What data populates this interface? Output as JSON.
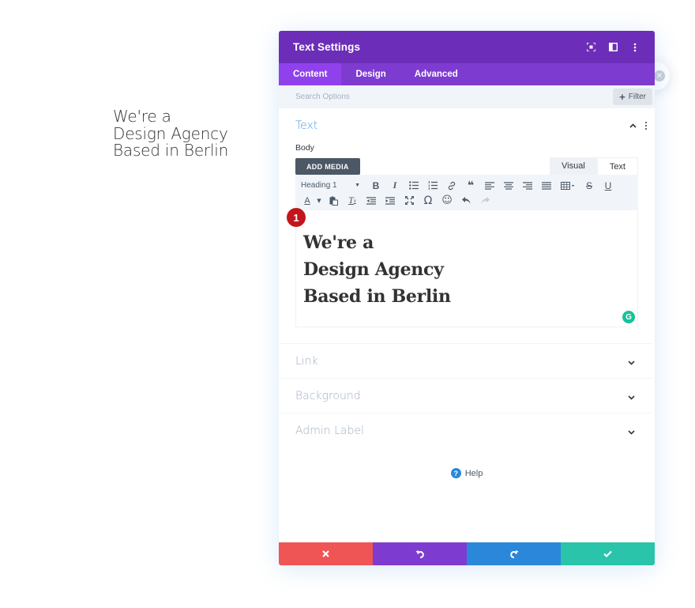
{
  "preview": {
    "lines": [
      "We're a",
      "Design Agency",
      "Based in Berlin"
    ]
  },
  "modal": {
    "title": "Text Settings",
    "header_icons": [
      "focus-icon",
      "split-view-icon",
      "more-options-icon"
    ],
    "tabs": [
      {
        "label": "Content",
        "active": true
      },
      {
        "label": "Design",
        "active": false
      },
      {
        "label": "Advanced",
        "active": false
      }
    ],
    "search": {
      "placeholder": "Search Options"
    },
    "filter": {
      "label": "Filter",
      "icon": "plus-icon"
    },
    "text_section": {
      "title": "Text",
      "body_label": "Body",
      "add_media_label": "ADD MEDIA",
      "mode_tabs": {
        "visual": "Visual",
        "text": "Text"
      },
      "format_select": "Heading 1",
      "toolbar_row1": [
        "bold",
        "italic",
        "bullet-list",
        "numbered-list",
        "link",
        "blockquote",
        "align-left",
        "align-center",
        "align-right",
        "align-justify",
        "table",
        "strikethrough",
        "underline"
      ],
      "toolbar_row2": [
        "text-color",
        "paste-as-text",
        "clear-formatting",
        "outdent",
        "indent",
        "fullscreen",
        "special-character",
        "emoji",
        "undo",
        "redo"
      ],
      "editor_content": [
        "We're a",
        "Design Agency",
        "Based in Berlin"
      ],
      "badge_number": "1",
      "grammarly_glyph": "G"
    },
    "collapsed_sections": [
      {
        "title": "Link"
      },
      {
        "title": "Background"
      },
      {
        "title": "Admin Label"
      }
    ],
    "help": {
      "label": "Help",
      "icon_glyph": "?"
    },
    "footer": [
      {
        "action": "discard",
        "color": "#ef5555"
      },
      {
        "action": "undo",
        "color": "#7e3bd0"
      },
      {
        "action": "redo",
        "color": "#2b87da"
      },
      {
        "action": "save",
        "color": "#29c4a9"
      }
    ]
  },
  "colors": {
    "header": "#6c2eb9",
    "tabs": "#7e3bd0",
    "active_tab": "#8f42ec",
    "accent_blue": "#2b87da",
    "badge_red": "#c2161c",
    "grammarly": "#15c39a"
  }
}
